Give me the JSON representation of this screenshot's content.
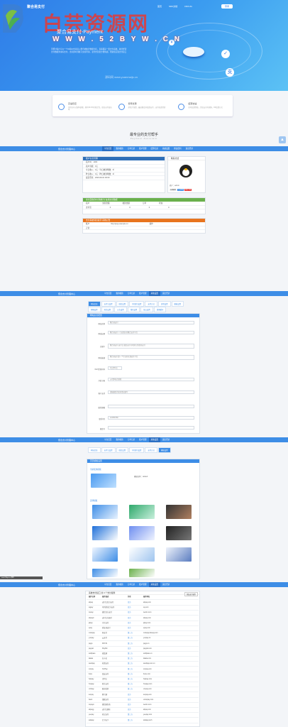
{
  "hero": {
    "brand": "聚合易支付",
    "nav": [
      "首页",
      "SDK文档",
      "FDCUG"
    ],
    "login": "登录",
    "title": "聚合易支付-Payment",
    "subtitle": "天聚付客户可以一个ID和UI中对接入整合地统计数据分析，直接都是一套支付系统，融合经营支付数据查询库支付，支持即时到账与交易查询，业务经营更方便快捷，帮助您实现支付接口",
    "watermark": "白芸资源网",
    "watermark_url": "W W W . 5 2 B Y W . C N",
    "watermark_small": "源码网 www.yuanmaijs.cn"
  },
  "features": [
    {
      "title": "高速稳定",
      "desc": "采用分布式架构部署，拥有99.9%的稳定性，保证支付成功率"
    },
    {
      "title": "费率优惠",
      "desc": "超低手续费，最高额度多结算支付，支持各类经营"
    },
    {
      "title": "结算快速",
      "desc": "实时结算到账，资金安全有保障，D0结算方式"
    }
  ],
  "section": {
    "title": "最专业的支付帮手",
    "subtitle": "Payment Assistant"
  },
  "admin": {
    "brand": "聚合支付管理中心",
    "nav": [
      "平台首页",
      "我的收款",
      "订单记录",
      "账户管理",
      "结算记录",
      "系统设置",
      "修改密码",
      "退出登录"
    ],
    "account_panel": "账户信息管理",
    "account_rows": [
      "商户ID：1000",
      "商户余额：0元",
      "今日收入：0元（今日收款笔数：0）",
      "昨日收入：0元（昨日收款笔数：0）",
      "最近登录：2023-09-01 00:00"
    ],
    "contact_panel": "联系方式",
    "contact_name": "商户：admin",
    "contact_btns": [
      "在线联系",
      "QQ咨询",
      "提交工单"
    ],
    "orders_panel": "支付宝收款(付款统计)  在线交易数据",
    "orders_cols": [
      "商户",
      "交易金额",
      "收款金额",
      "订单",
      "状态"
    ],
    "orders_row": [
      "支付宝",
      "0",
      "0",
      "0",
      "0"
    ],
    "settle_panel": "支付系统消息提示  系统公告",
    "settle_cols": [
      "账户",
      "http://pay.example.cn",
      "操作"
    ],
    "settle_row": [
      "正常",
      "",
      ""
    ]
  },
  "settings": {
    "tabs": [
      "网站信息",
      "支付宝设置",
      "微信设置",
      "QQ钱包设置",
      "支付方式",
      "其他设置",
      "模板设置"
    ],
    "tabs2": [
      "邮箱设置",
      "短信设置",
      "公告设置",
      "域名设置",
      "接口设置",
      "清理缓存"
    ],
    "panel": "网站信息配置",
    "rows": [
      {
        "label": "网站名称",
        "value": "聚合易支付"
      },
      {
        "label": "网站标题",
        "value": "聚合易支付 - 行业领先的聚合支付平台"
      },
      {
        "label": "关键字",
        "value": "聚合易支付,支付宝,微信支付,QQ钱包,免签约支付"
      },
      {
        "label": "网站描述",
        "value": "聚合易支付是一个专业的在线支付平台"
      },
      {
        "label": "KEY提现时间",
        "value": "0点至24点"
      },
      {
        "label": "开发节奏",
        "value": "从0到1每次更新"
      },
      {
        "label": "客户支持",
        "value": "请根据您的实际情况填写"
      },
      {
        "label": "联系邮箱",
        "value": ""
      },
      {
        "label": "联系QQ",
        "value": "123456789"
      },
      {
        "label": "备案号",
        "value": ""
      }
    ]
  },
  "templates": {
    "panel": "首页模板设置",
    "current_label": "当前使用模板",
    "current_name": "模板名称：default",
    "choose_label": "选择模板"
  },
  "channels": {
    "panel": "系统支付接口 共 0 个支付插件",
    "btn": "添加支付插件",
    "cols": [
      "插件名称",
      "插件描述",
      "作者",
      "插件网址"
    ],
    "rows": [
      [
        "alipay",
        "支付宝官方支付",
        "官方",
        "alipay.com"
      ],
      [
        "qqpay",
        "QQ钱包官方支付",
        "官方",
        "qq.com"
      ],
      [
        "wxpay",
        "微信官方支付",
        "官方",
        "weixin.com"
      ],
      [
        "alipayd",
        "支付宝当面付",
        "官方",
        "alipay.com"
      ],
      [
        "jdpay",
        "京东支付",
        "官方",
        "jdpay.com"
      ],
      [
        "epay",
        "彩虹易支付",
        "官方",
        "epay.com"
      ],
      [
        "codepay",
        "码支付",
        "第三方",
        "codepay.fateqq.com"
      ],
      [
        "yunpay",
        "云支付",
        "第三方",
        "yunpay.cn"
      ],
      [
        "payjs",
        "PAYJS",
        "第三方",
        "payjs.cn"
      ],
      [
        "paypal",
        "PayPal",
        "官方",
        "paypal.com"
      ],
      [
        "swiftpass",
        "威富通",
        "第三方",
        "swiftpass.cn"
      ],
      [
        "lakala",
        "拉卡拉",
        "第三方",
        "lakala.com"
      ],
      [
        "sandpay",
        "杉德支付",
        "第三方",
        "sandpay.com.cn"
      ],
      [
        "xorpay",
        "XorPay",
        "第三方",
        "xorpay.com"
      ],
      [
        "fuiou",
        "富友支付",
        "第三方",
        "fuiou.com"
      ],
      [
        "helipay",
        "合利宝",
        "第三方",
        "helipay.com"
      ],
      [
        "hnapay",
        "新生支付",
        "第三方",
        "hnapay.com"
      ],
      [
        "umfpay",
        "联动优势",
        "第三方",
        "umpay.com"
      ],
      [
        "tenpay",
        "财付通",
        "官方",
        "tenpay.com"
      ],
      [
        "bank",
        "银联支付",
        "官方",
        "unionpay.com"
      ],
      [
        "wxpayn",
        "微信服务商",
        "官方",
        "weixin.com"
      ],
      [
        "alipayg",
        "支付宝国际",
        "官方",
        "alipay.com"
      ],
      [
        "yeepay",
        "易宝支付",
        "第三方",
        "yeepay.com"
      ],
      [
        "adapay",
        "汇付天下",
        "第三方",
        "adapay.tech"
      ]
    ]
  },
  "footer": "www.52byw.cn 源码"
}
